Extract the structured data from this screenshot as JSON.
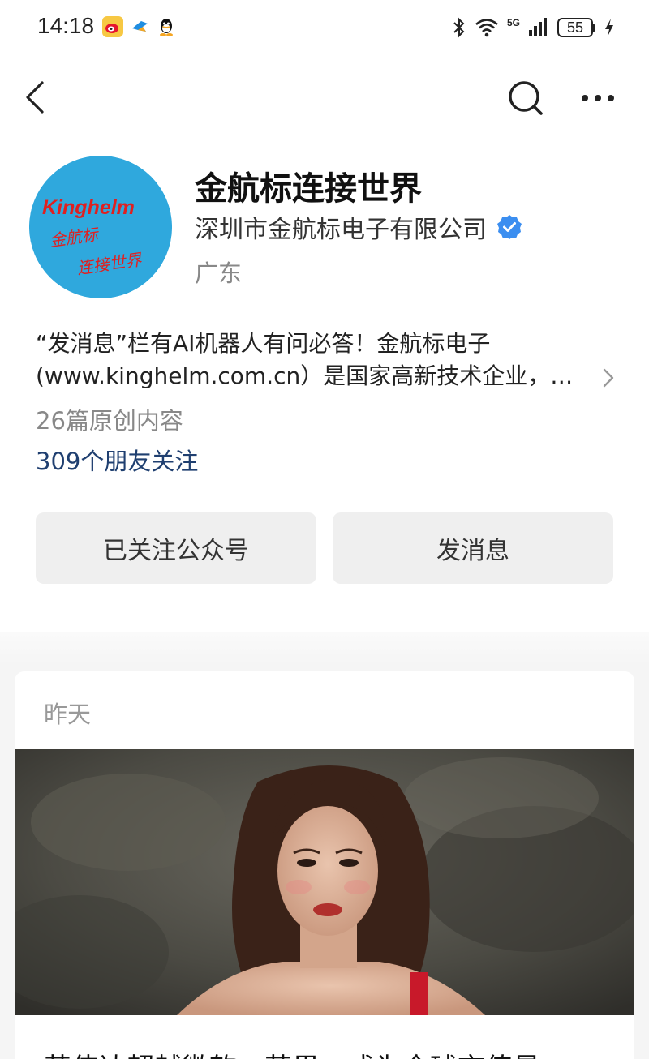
{
  "status_bar": {
    "time": "14:18",
    "network": "5G",
    "battery": "55",
    "left_icons": [
      "weibo-icon",
      "bird-app-icon",
      "qq-icon"
    ],
    "right_icons": [
      "bluetooth-icon",
      "wifi-icon",
      "signal-icon",
      "battery-icon",
      "charging-icon"
    ]
  },
  "nav": {
    "back_icon": "back-chevron-icon",
    "search_icon": "search-icon",
    "more_icon": "more-dots-icon"
  },
  "profile": {
    "avatar_logo_text": "Kinghelm",
    "avatar_slogan_line1": "金航标",
    "avatar_slogan_line2": "连接世界",
    "name": "金航标连接世界",
    "company": "深圳市金航标电子有限公司",
    "verified": true,
    "region": "广东",
    "description": "“发消息”栏有AI机器人有问必答！金航标电子(www.kinghelm.com.cn）是国家高新技术企业，…",
    "original_count": "26篇原创内容",
    "friends_follow": "309个朋友关注"
  },
  "actions": {
    "followed_label": "已关注公众号",
    "message_label": "发消息"
  },
  "feed": {
    "date_label": "昨天",
    "article_title": "英伟达超越微软、苹果，成为全球市值最"
  },
  "colors": {
    "accent_link": "#1f3f70",
    "verified_blue": "#3b8ef0",
    "avatar_blue": "#2fa8dd",
    "logo_red": "#e02020",
    "button_bg": "#efefef"
  }
}
